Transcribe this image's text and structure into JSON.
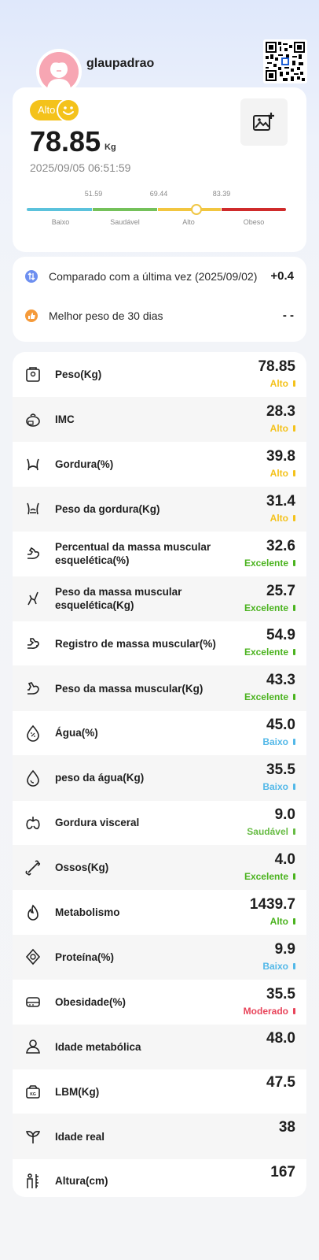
{
  "colors": {
    "alto": "#f4c21b",
    "excelente": "#4bb31f",
    "baixo": "#53b8e8",
    "saudavel": "#67bc44",
    "moderado": "#e8445a",
    "scale_low": "#5bc2dc",
    "scale_healthy": "#74c15a",
    "scale_high": "#f2c640",
    "scale_obese": "#cf2b2b"
  },
  "header": {
    "username": "glaupadrao",
    "avatar_icon": "user-avatar-icon",
    "qr_icon": "qr-code-icon"
  },
  "summary": {
    "status_badge": "Alto",
    "weight": "78.85",
    "unit": "Kg",
    "date": "2025/09/05 06:51:59",
    "photo_icon": "add-image-icon",
    "scale": {
      "thresholds": [
        "51.59",
        "69.44",
        "83.39"
      ],
      "labels": [
        "Baixo",
        "Saudável",
        "Alto",
        "Obeso"
      ],
      "marker_position_fraction": 0.655
    }
  },
  "compare": {
    "last_label": "Comparado com a última vez (2025/09/02)",
    "last_value": "+0.4",
    "best_label": "Melhor peso de 30 dias",
    "best_value": "- -"
  },
  "metrics": [
    {
      "icon": "scale-icon",
      "label": "Peso(Kg)",
      "value": "78.85",
      "status": "Alto",
      "status_color": "#f4c21b"
    },
    {
      "icon": "bmi-icon",
      "label": "IMC",
      "value": "28.3",
      "status": "Alto",
      "status_color": "#f4c21b"
    },
    {
      "icon": "body-fat-icon",
      "label": "Gordura(%)",
      "value": "39.8",
      "status": "Alto",
      "status_color": "#f4c21b"
    },
    {
      "icon": "fat-mass-icon",
      "label": "Peso da gordura(Kg)",
      "value": "31.4",
      "status": "Alto",
      "status_color": "#f4c21b"
    },
    {
      "icon": "muscle-arm-icon",
      "label": "Percentual da massa muscular esquelética(%)",
      "value": "32.6",
      "status": "Excelente",
      "status_color": "#4bb31f"
    },
    {
      "icon": "skeletal-muscle-icon",
      "label": "Peso da massa muscular esquelética(Kg)",
      "value": "25.7",
      "status": "Excelente",
      "status_color": "#4bb31f"
    },
    {
      "icon": "muscle-rate-icon",
      "label": "Registro de massa muscular(%)",
      "value": "54.9",
      "status": "Excelente",
      "status_color": "#4bb31f"
    },
    {
      "icon": "muscle-weight-icon",
      "label": "Peso da massa muscular(Kg)",
      "value": "43.3",
      "status": "Excelente",
      "status_color": "#4bb31f"
    },
    {
      "icon": "water-percent-icon",
      "label": "Água(%)",
      "value": "45.0",
      "status": "Baixo",
      "status_color": "#53b8e8"
    },
    {
      "icon": "water-drop-icon",
      "label": "peso da água(Kg)",
      "value": "35.5",
      "status": "Baixo",
      "status_color": "#53b8e8"
    },
    {
      "icon": "visceral-fat-icon",
      "label": "Gordura visceral",
      "value": "9.0",
      "status": "Saudável",
      "status_color": "#67bc44"
    },
    {
      "icon": "bone-icon",
      "label": "Ossos(Kg)",
      "value": "4.0",
      "status": "Excelente",
      "status_color": "#4bb31f"
    },
    {
      "icon": "metabolism-flame-icon",
      "label": "Metabolismo",
      "value": "1439.7",
      "status": "Alto",
      "status_color": "#4bb31f"
    },
    {
      "icon": "protein-icon",
      "label": "Proteína(%)",
      "value": "9.9",
      "status": "Baixo",
      "status_color": "#53b8e8"
    },
    {
      "icon": "obesity-icon",
      "label": "Obesidade(%)",
      "value": "35.5",
      "status": "Moderado",
      "status_color": "#e8445a"
    },
    {
      "icon": "metabolic-age-icon",
      "label": "Idade metabólica",
      "value": "48.0",
      "status": "",
      "status_color": ""
    },
    {
      "icon": "lbm-icon",
      "label": "LBM(Kg)",
      "value": "47.5",
      "status": "",
      "status_color": ""
    },
    {
      "icon": "sprout-icon",
      "label": "Idade real",
      "value": "38",
      "status": "",
      "status_color": ""
    },
    {
      "icon": "height-icon",
      "label": "Altura(cm)",
      "value": "167",
      "status": "",
      "status_color": ""
    }
  ]
}
